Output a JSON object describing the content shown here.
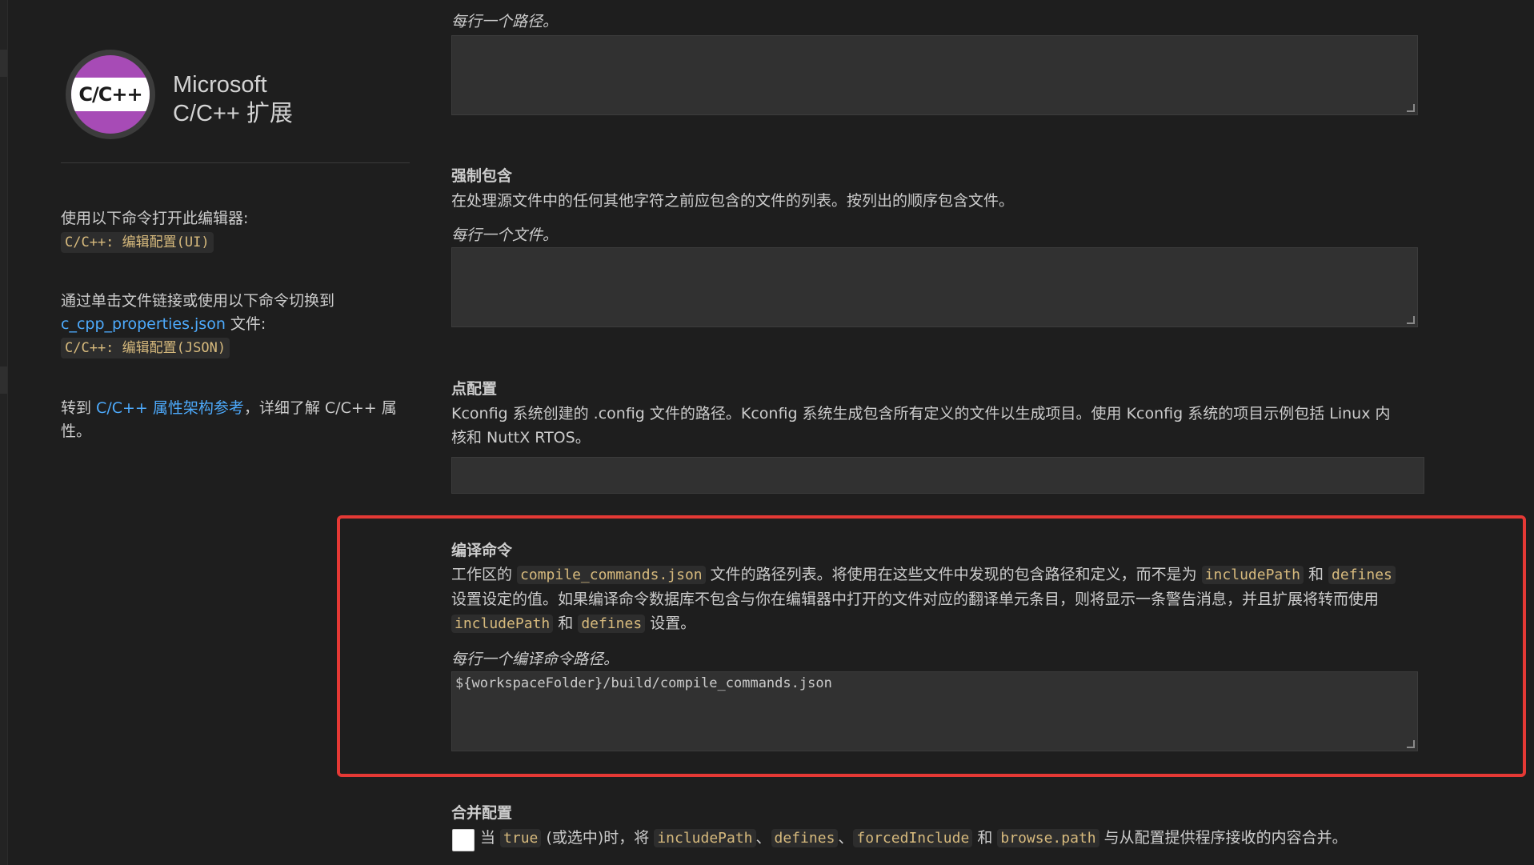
{
  "sidebar": {
    "logo_text": "C/C++",
    "brand_line1": "Microsoft",
    "brand_line2": "C/C++ 扩展",
    "open_editor_text": "使用以下命令打开此编辑器:",
    "open_editor_cmd": "C/C++: 编辑配置(UI)",
    "switch_text": "通过单击文件链接或使用以下命令切换到",
    "switch_link": "c_cpp_properties.json",
    "switch_suffix": " 文件:",
    "switch_cmd": "C/C++: 编辑配置(JSON)",
    "goto_prefix": "转到 ",
    "goto_link": "C/C++ 属性架构参考",
    "goto_suffix": "，详细了解 C/C++ 属性。"
  },
  "main": {
    "top_hint": "每行一个路径。",
    "forced_include": {
      "title": "强制包含",
      "desc": "在处理源文件中的任何其他字符之前应包含的文件的列表。按列出的顺序包含文件。",
      "hint": "每行一个文件。",
      "value": ""
    },
    "dot_config": {
      "title": "点配置",
      "desc": "Kconfig 系统创建的 .config 文件的路径。Kconfig 系统生成包含所有定义的文件以生成项目。使用 Kconfig 系统的项目示例包括 Linux 内核和 NuttX RTOS。",
      "value": ""
    },
    "compile_commands": {
      "title": "编译命令",
      "desc_p1": "工作区的 ",
      "chip_file": "compile_commands.json",
      "desc_p2": " 文件的路径列表。将使用在这些文件中发现的包含路径和定义，而不是为 ",
      "chip_include": "includePath",
      "desc_p3": " 和 ",
      "chip_defines": "defines",
      "desc_p4": " 设置设定的值。如果编译命令数据库不包含与你在编辑器中打开的文件对应的翻译单元条目，则将显示一条警告消息，并且扩展将转而使用 ",
      "chip_include2": "includePath",
      "desc_p5": " 和 ",
      "chip_defines2": "defines",
      "desc_p6": " 设置。",
      "hint": "每行一个编译命令路径。",
      "value": "${workspaceFolder}/build/compile_commands.json"
    },
    "merge_config": {
      "title": "合并配置",
      "p1": "当 ",
      "chip_true": "true",
      "p2": " (或选中)时，将 ",
      "chip_include": "includePath",
      "sep1": "、",
      "chip_defines": "defines",
      "sep2": "、",
      "chip_forced": "forcedInclude",
      "p3": " 和 ",
      "chip_browse": "browse.path",
      "p4": " 与从配置提供程序接收的内容合并。"
    }
  },
  "colors": {
    "accent_link": "#4daafc",
    "code_chip": "#d7ba7d",
    "highlight_border": "#e53935",
    "logo_purple": "#a74bb6"
  }
}
